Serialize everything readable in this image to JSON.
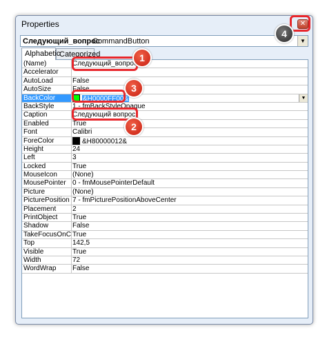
{
  "window": {
    "title": "Properties"
  },
  "object_selector": {
    "name": "Следующий_вопрос",
    "type": "CommandButton"
  },
  "tabs": [
    {
      "label": "Alphabetic"
    },
    {
      "label": "Categorized"
    }
  ],
  "properties": [
    {
      "name": "(Name)",
      "value": "Следующий_вопрос"
    },
    {
      "name": "Accelerator",
      "value": ""
    },
    {
      "name": "AutoLoad",
      "value": "False"
    },
    {
      "name": "AutoSize",
      "value": "False"
    },
    {
      "name": "BackColor",
      "value": "&H0000FF00&",
      "swatch": "#00ff00"
    },
    {
      "name": "BackStyle",
      "value": "1 - fmBackStyleOpaque"
    },
    {
      "name": "Caption",
      "value": "Следующий вопрос"
    },
    {
      "name": "Enabled",
      "value": "True"
    },
    {
      "name": "Font",
      "value": "Calibri"
    },
    {
      "name": "ForeColor",
      "value": "&H80000012&",
      "swatch": "#000000"
    },
    {
      "name": "Height",
      "value": "24"
    },
    {
      "name": "Left",
      "value": "3"
    },
    {
      "name": "Locked",
      "value": "True"
    },
    {
      "name": "MouseIcon",
      "value": "(None)"
    },
    {
      "name": "MousePointer",
      "value": "0 - fmMousePointerDefault"
    },
    {
      "name": "Picture",
      "value": "(None)"
    },
    {
      "name": "PicturePosition",
      "value": "7 - fmPicturePositionAboveCenter"
    },
    {
      "name": "Placement",
      "value": "2"
    },
    {
      "name": "PrintObject",
      "value": "True"
    },
    {
      "name": "Shadow",
      "value": "False"
    },
    {
      "name": "TakeFocusOnClick",
      "value": "True"
    },
    {
      "name": "Top",
      "value": "142,5"
    },
    {
      "name": "Visible",
      "value": "True"
    },
    {
      "name": "Width",
      "value": "72"
    },
    {
      "name": "WordWrap",
      "value": "False"
    }
  ],
  "callouts": [
    {
      "label": "1"
    },
    {
      "label": "2"
    },
    {
      "label": "3"
    },
    {
      "label": "4"
    }
  ],
  "colors": {
    "highlight": "#e8262b",
    "selection": "#3399ff"
  }
}
